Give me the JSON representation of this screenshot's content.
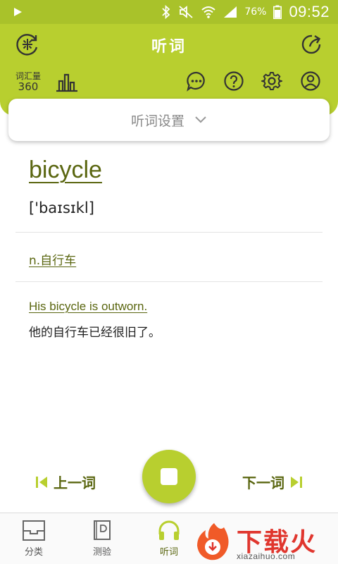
{
  "status_bar": {
    "battery": "76%",
    "time": "09:52"
  },
  "header": {
    "title": "听词",
    "vocab_label": "词汇量",
    "vocab_count": "360"
  },
  "settings": {
    "label": "听词设置"
  },
  "word": {
    "text": "bicycle",
    "phonetic": "['baɪsɪkl]",
    "meaning": "n.自行车",
    "example_en": "His bicycle is outworn.",
    "example_cn": "他的自行车已经很旧了。"
  },
  "controls": {
    "prev_label": "上一词",
    "next_label": "下一词"
  },
  "bottom_nav": {
    "items": [
      {
        "label": "分类",
        "icon": "folder-icon"
      },
      {
        "label": "测验",
        "icon": "book-icon"
      },
      {
        "label": "听词",
        "icon": "headphones-icon",
        "active": true
      }
    ]
  },
  "watermark": {
    "text": "下载火",
    "url": "xiazaihuo.com"
  },
  "colors": {
    "accent": "#b8cf2f",
    "status_bar": "#a9c22a",
    "text_green": "#5a6610",
    "watermark_red": "#e0362e"
  }
}
